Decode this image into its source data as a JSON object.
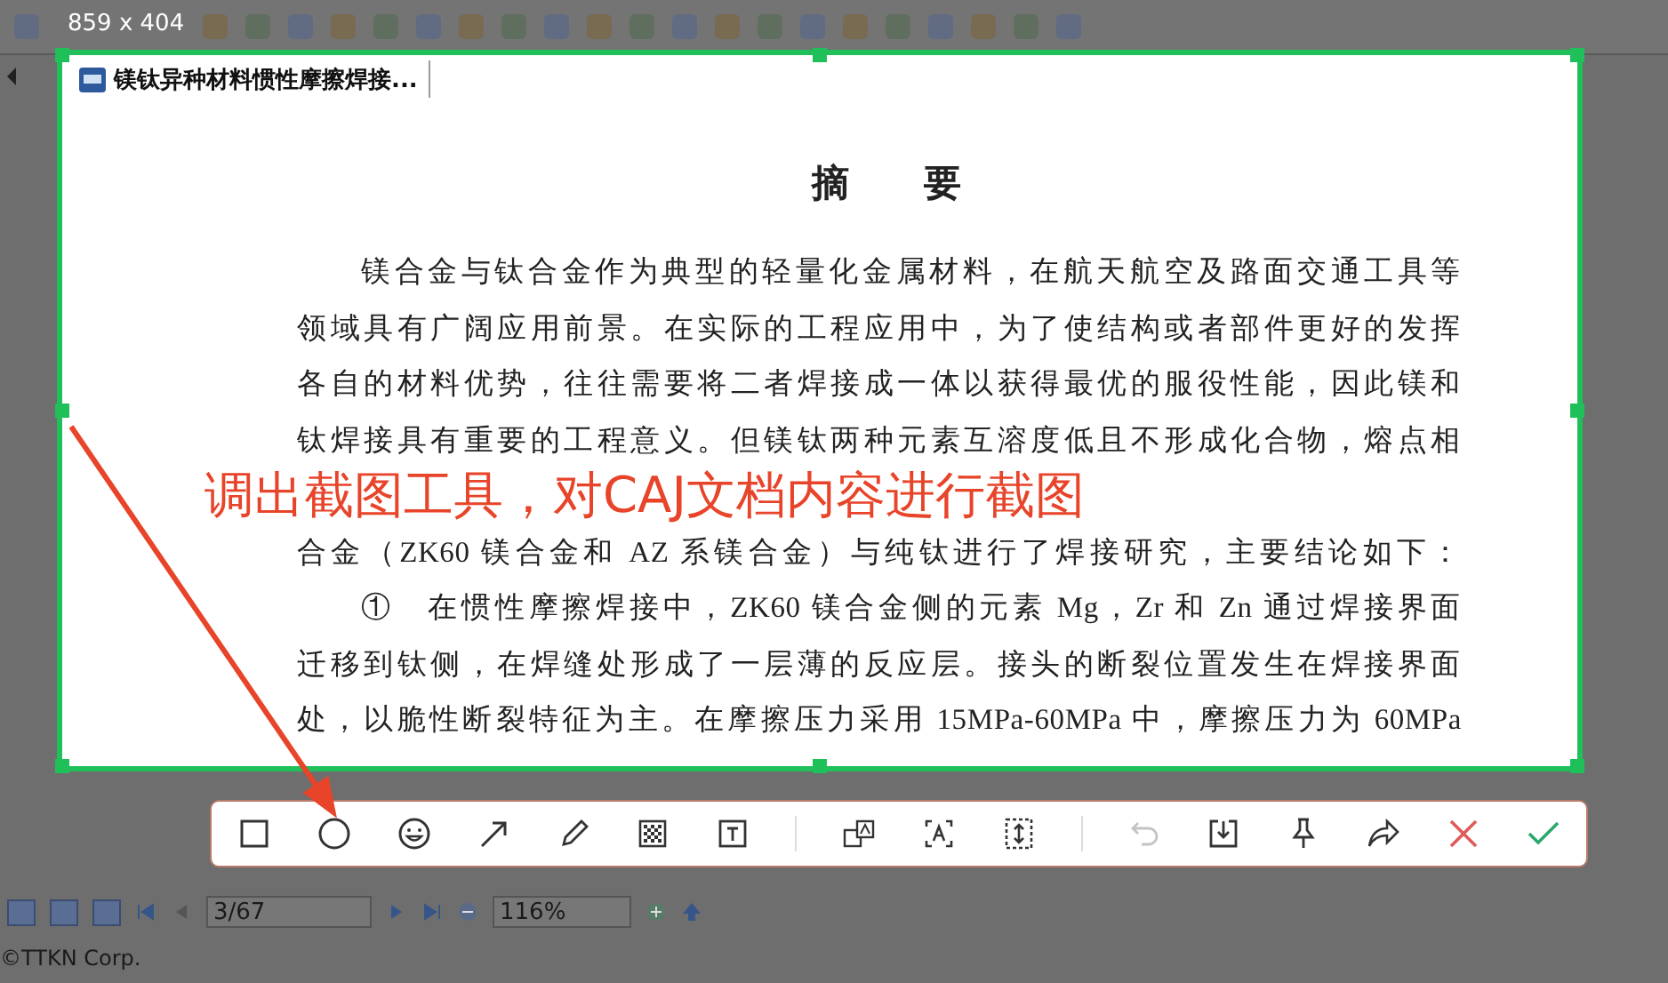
{
  "capture": {
    "size_label": "859 x 404",
    "annotation": "调出截图工具，对CAJ文档内容进行截图"
  },
  "tab": {
    "title": "镁钛异种材料惯性摩擦焊接..."
  },
  "document": {
    "heading": "摘　　要",
    "lines": [
      {
        "text": "镁合金与钛合金作为典型的轻量化金属材料，在航天航空及路面交通工具等",
        "indent": true
      },
      {
        "text": "领域具有广阔应用前景。在实际的工程应用中，为了使结构或者部件更好的发挥",
        "indent": false
      },
      {
        "text": "各自的材料优势，往往需要将二者焊接成一体以获得最优的服役性能，因此镁和",
        "indent": false
      },
      {
        "text": "钛焊接具有重要的工程意义。但镁钛两种元素互溶度低且不形成化合物，熔点相",
        "indent": false
      },
      {
        "text": "合金（ZK60 镁合金和 AZ 系镁合金）与纯钛进行了焊接研究，主要结论如下：",
        "indent": false
      },
      {
        "text": "①　在惯性摩擦焊接中，ZK60 镁合金侧的元素 Mg，Zr 和 Zn 通过焊接界面",
        "indent": true
      },
      {
        "text": "迁移到钛侧，在焊缝处形成了一层薄的反应层。接头的断裂位置发生在焊接界面",
        "indent": false
      },
      {
        "text": "处，以脆性断裂特征为主。在摩擦压力采用 15MPa-60MPa 中，摩擦压力为 60MPa",
        "indent": false
      }
    ]
  },
  "capture_toolbar": {
    "undo": {
      "disabled": true
    }
  },
  "navigation": {
    "page": "3/67",
    "zoom": "116%"
  },
  "status_bar": "©TTKN Corp."
}
